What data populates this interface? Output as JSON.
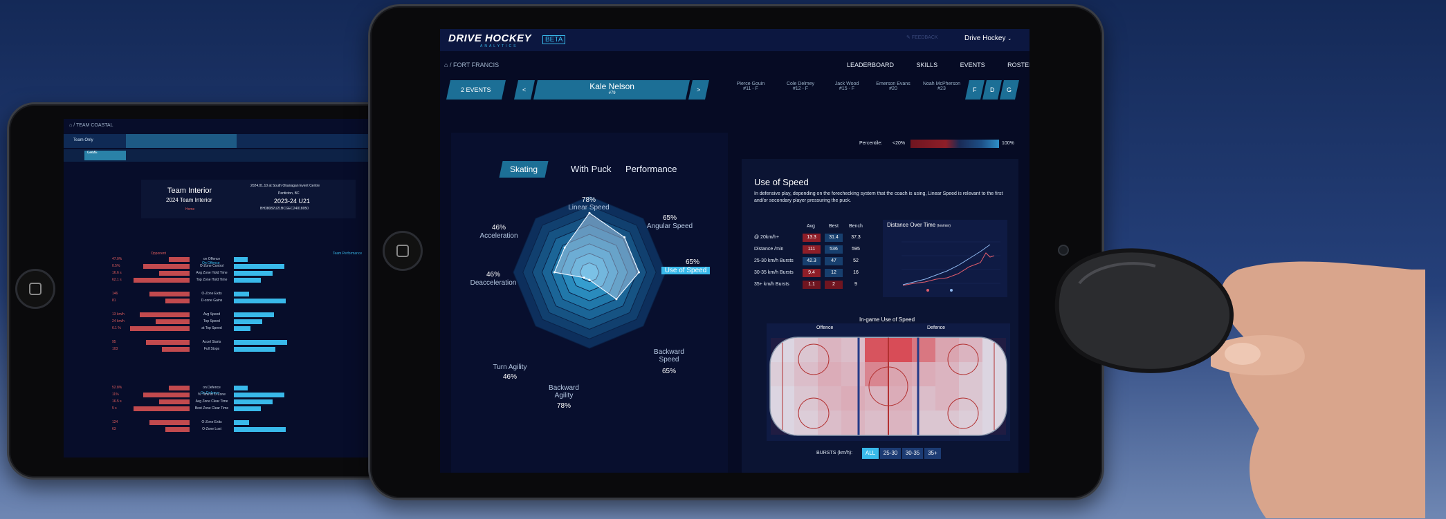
{
  "left_screen": {
    "breadcrumb": "/ TEAM COASTAL",
    "filter_label": "Team Only",
    "event_tag": "GAME",
    "team_name": "Team Interior",
    "team_subtitle": "2024 Team Interior",
    "team_link": "Home",
    "event_date_line": "2024.01.10 at South Okanagan Event Centre",
    "event_location": "Penticton, BC",
    "event_title": "2023-24 U21",
    "event_code": "BH38082U21BCGEC24018050",
    "opponent_label": "Opponent",
    "team_perf_label": "Team Performance",
    "on_offence_label": "On Offence",
    "on_defence_label": "On Defence",
    "offence_rows": [
      {
        "label": "on Offence",
        "value": "47.0%"
      },
      {
        "label": "O-Zone Control",
        "value": "0.5%"
      },
      {
        "label": "Avg Zone Hold Time",
        "value": "16.6 s"
      },
      {
        "label": "Top Zone Hold Time",
        "value": "62.1 s"
      },
      {
        "label": "O-Zone Exits",
        "value": "146"
      },
      {
        "label": "D-zone Gains",
        "value": "81"
      },
      {
        "label": "Avg Speed",
        "value": "13 km/h"
      },
      {
        "label": "Top Speed",
        "value": "24 km/h"
      },
      {
        "label": "at Top Speed",
        "value": "6.1 %"
      },
      {
        "label": "Accel Starts",
        "value": "95"
      },
      {
        "label": "Full Stops",
        "value": "103"
      }
    ],
    "defence_rows": [
      {
        "label": "on Defence",
        "value": "52.8%"
      },
      {
        "label": "% Time in D-Zone",
        "value": "11%"
      },
      {
        "label": "Avg Zone Clear Time",
        "value": "16.5 s"
      },
      {
        "label": "Best Zone Clear Time",
        "value": "5 s"
      },
      {
        "label": "O-Zone Exits",
        "value": "124"
      },
      {
        "label": "O-Zone Lost",
        "value": "63"
      }
    ]
  },
  "header": {
    "logo_main": "DRIVE HOCKEY",
    "logo_sub": "ANALYTICS",
    "beta": "BETA",
    "feedback": "FEEDBACK",
    "account": "Drive Hockey",
    "breadcrumb": "/ FORT FRANCIS",
    "nav": [
      "LEADERBOARD",
      "SKILLS",
      "EVENTS",
      "ROSTER"
    ]
  },
  "player_bar": {
    "events_button": "2 EVENTS",
    "prev": "<",
    "next": ">",
    "player_name": "Kale Nelson",
    "player_number": "#79",
    "other_players": [
      {
        "name": "Pierce Gouin",
        "meta": "#11 - F"
      },
      {
        "name": "Cole Delmey",
        "meta": "#12 - F"
      },
      {
        "name": "Jack Wood",
        "meta": "#15 - F"
      },
      {
        "name": "Emerson Evans",
        "meta": "#20"
      },
      {
        "name": "Noah McPherson",
        "meta": "#23"
      }
    ],
    "position_filters": [
      "F",
      "D",
      "G"
    ]
  },
  "percentile": {
    "label": "Percentile:",
    "low": "<20%",
    "high": "100%"
  },
  "skill_tabs": [
    "Skating",
    "With Puck",
    "Performance"
  ],
  "radar": {
    "axes": [
      {
        "label": "Linear Speed",
        "value": "78%",
        "v": 0.78
      },
      {
        "label": "Angular Speed",
        "value": "65%",
        "v": 0.65
      },
      {
        "label": "Use of Speed",
        "value": "65%",
        "v": 0.65
      },
      {
        "label": "Backward Speed",
        "value": "65%",
        "v": 0.5
      },
      {
        "label": "Backward Agility",
        "value": "78%",
        "v": 0.1
      },
      {
        "label": "Turn Agility",
        "value": "46%",
        "v": 0.1
      },
      {
        "label": "Deacceleration",
        "value": "46%",
        "v": 0.46
      },
      {
        "label": "Acceleration",
        "value": "46%",
        "v": 0.46
      }
    ]
  },
  "detail": {
    "title": "Use of Speed",
    "description": "In defensive play, depending on the forechecking system that the coach is using, Linear Speed is relevant to the first and/or secondary player pressuring the puck.",
    "columns": [
      "Avg",
      "Best",
      "Bench"
    ],
    "rows": [
      {
        "label": "@ 20km/h+",
        "avg": "13.3",
        "best": "31.4",
        "bench": "37.3"
      },
      {
        "label": "Distance /min",
        "avg": "111",
        "best": "536",
        "bench": "595"
      },
      {
        "label": "25-30 km/h Bursts",
        "avg": "42.3",
        "best": "47",
        "bench": "52"
      },
      {
        "label": "30-35 km/h Bursts",
        "avg": "9.4",
        "best": "12",
        "bench": "16"
      },
      {
        "label": "35+ km/h Bursts",
        "avg": "1.1",
        "best": "2",
        "bench": "9"
      }
    ],
    "distance_chart_title": "Distance Over Time",
    "distance_chart_unit": "(km/min)",
    "rink_title": "In-game Use of Speed",
    "rink_offence": "Offence",
    "rink_defence": "Defence",
    "bursts_label": "BURSTS (km/h):",
    "bursts_options": [
      "ALL",
      "25-30",
      "30-35",
      "35+"
    ]
  },
  "colors": {
    "accent": "#39b9ea",
    "panel": "#0b1433",
    "bad": "#8e1e28",
    "good": "#173f6e"
  }
}
